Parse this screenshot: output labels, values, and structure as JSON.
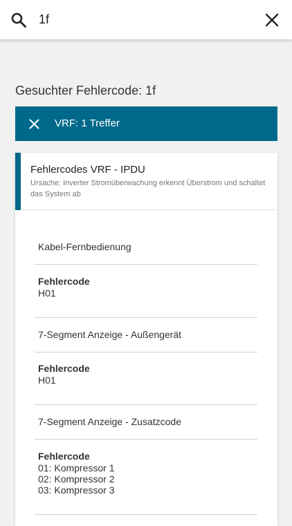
{
  "search": {
    "query": "1f"
  },
  "heading": "Gesuchter Fehlercode: 1f",
  "result_bar": {
    "label": "VRF: 1 Treffer"
  },
  "card": {
    "title": "Fehlercodes VRF - IPDU",
    "subtitle": "Ursache: Inverter Stromüberwachung erkennt Überstrom und schaltet das System ab",
    "sections": [
      {
        "title": "Kabel-Fernbedienung",
        "field_label": "Fehlercode",
        "field_value": "H01"
      },
      {
        "title": "7-Segment Anzeige - Außengerät",
        "field_label": "Fehlercode",
        "field_value": "H01"
      },
      {
        "title": "7-Segment Anzeige - Zusatzcode",
        "field_label": "Fehlercode",
        "field_value_lines": [
          "01: Kompressor 1",
          "02: Kompressor 2",
          "03: Kompressor 3"
        ]
      }
    ]
  },
  "colors": {
    "accent": "#00698b",
    "background": "#f1f1f1"
  },
  "icons": [
    "search-icon",
    "close-icon",
    "close-small-icon"
  ]
}
